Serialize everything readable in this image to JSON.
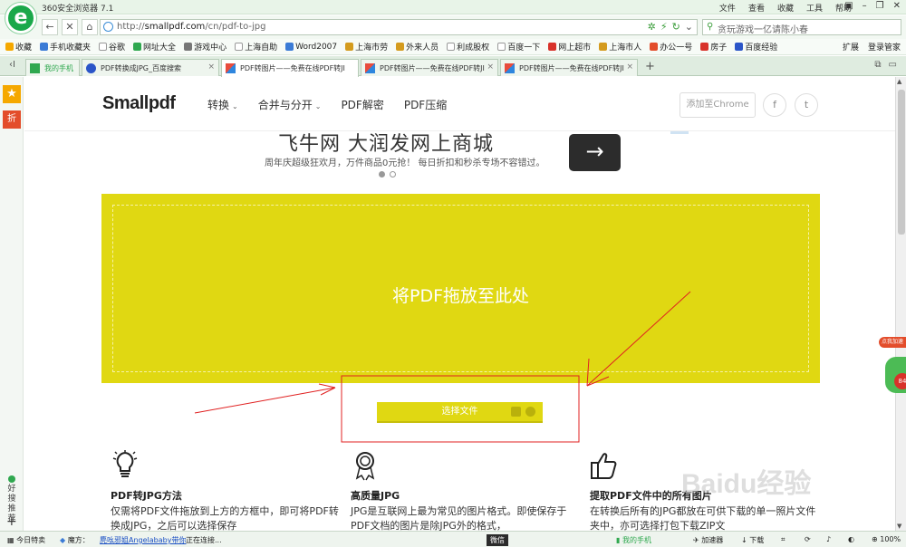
{
  "browser": {
    "app_title": "360安全浏览器 7.1",
    "logo_letter": "e",
    "menus": [
      "文件",
      "查看",
      "收藏",
      "工具",
      "帮助"
    ],
    "url_prefix": "http://",
    "url_domain": "smallpdf.com",
    "url_path": "/cn/pdf-to-jpg",
    "search_placeholder": "贪玩游戏一亿请陈小春",
    "bookmarks": [
      "收藏",
      "手机收藏夹",
      "谷歌",
      "网址大全",
      "游戏中心",
      "上海自助",
      "Word2007",
      "上海市劳",
      "外来人员",
      "利成股权",
      "百度一下",
      "网上超市",
      "上海市人",
      "办公一号",
      "房子",
      "百度经验"
    ],
    "bookmarks_right": [
      "扩展",
      "登录管家"
    ],
    "tabs": [
      {
        "label": "我的手机",
        "icon": "phone-icon"
      },
      {
        "label": "PDF转换成JPG_百度搜索",
        "icon": "baidu-icon"
      },
      {
        "label": "PDF转图片——免费在线PDF转JI",
        "icon": "smallpdf-icon"
      },
      {
        "label": "PDF转图片——免费在线PDF转JI",
        "icon": "smallpdf-icon"
      },
      {
        "label": "PDF转图片——免费在线PDF转JI",
        "icon": "smallpdf-icon"
      }
    ],
    "sidebar": {
      "zhe": "折",
      "good": "好搜推荐"
    }
  },
  "site": {
    "logo": "Smallpdf",
    "nav": [
      "转换",
      "合并与分开",
      "PDF解密",
      "PDF压缩"
    ],
    "chrome_button": "添加至Chrome",
    "fb": "f",
    "tw": "t"
  },
  "ad": {
    "headline": "飞牛网 大润发网上商城",
    "sub": "周年庆超级狂欢月，万件商品0元抢！ 每日折扣和秒杀专场不容错过。",
    "arrow": "→"
  },
  "dropzone": {
    "text": "将PDF拖放至此处",
    "choose_button": "选择文件"
  },
  "features": [
    {
      "title": "PDF转JPG方法",
      "desc": "仅需将PDF文件拖放到上方的方框中，即可将PDF转换成JPG，之后可以选择保存"
    },
    {
      "title": "高质量JPG",
      "desc": "JPG是互联网上最为常见的图片格式。即使保存于PDF文档的图片是除JPG外的格式，"
    },
    {
      "title": "提取PDF文件中的所有图片",
      "desc": "在转换后所有的JPG都放在可供下载的单一照片文件夹中，亦可选择打包下载ZIP文"
    }
  ],
  "widget": {
    "bubble": "点我加速",
    "num": "84"
  },
  "watermark": "Baidu经验",
  "status": {
    "today": "今日特卖",
    "magic": "魔方：",
    "news": "麂吆邪姐Angelababy带你",
    "connecting": "正在连接...",
    "weixin": "微信",
    "my_phone": "我的手机",
    "accel": "加速器",
    "download": "下载",
    "zoom": "100%"
  }
}
